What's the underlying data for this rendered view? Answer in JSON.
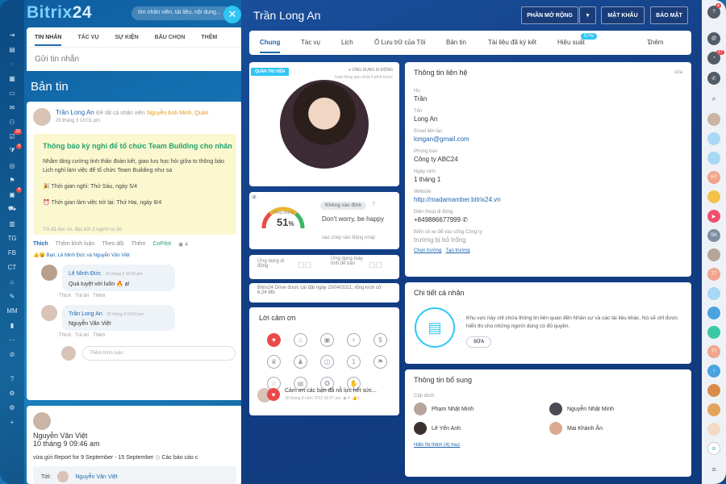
{
  "app": {
    "brand_part1": "Bitrix",
    "brand_part2": "24",
    "search_placeholder": "tìm nhân viên, tài liệu, nội dung..."
  },
  "leftnav": {
    "items": [
      "TG",
      "FB",
      "CT",
      "MM"
    ],
    "badges": [
      "18",
      "4",
      "4"
    ]
  },
  "feed": {
    "tabs": [
      "TIN NHẮN",
      "TÁC VỤ",
      "SỰ KIỆN",
      "BẦU CHỌN",
      "THÊM"
    ],
    "send_placeholder": "Gửi tin nhắn",
    "title": "Bản tin",
    "post": {
      "author": "Trần Long An",
      "to": "Đề tất cả nhân viên",
      "mention": "Nguyễn Anh Minh, Quản",
      "date": "25 tháng 3 10:01 pm",
      "headline": "Thông báo kỳ nghỉ để tổ chức Team Building cho nhân",
      "body": "Nhằm tăng cường tinh thần đoàn kết, giao lưu học hỏi giữa to thông báo Lịch nghỉ làm việc để tổ chức Team Building như sa",
      "line1": "Thời gian nghỉ: Thứ Sáu, ngày 5/4",
      "line2": "Thời gian làm việc trở lại: Thứ Hai, ngày 8/4",
      "readers": "Tôi đã đọc nó, đọc bởi 3 người tự đó",
      "actions": [
        "Thích",
        "Thêm bình luận",
        "Theo dõi",
        "Thêm",
        "CoPilot"
      ],
      "views": "4",
      "likes": "Bạn, Lê Minh Đức và Nguyễn Văn Việt",
      "comments": [
        {
          "name": "Lê Minh Đức",
          "date": "25 tháng 3 10:05 pm",
          "text": "Quá tuyệt vời luôn 🔥 ạ!"
        },
        {
          "name": "Trần Long An",
          "date": "25 tháng 3 10:53 pm",
          "text": "Nguyễn Văn Việt"
        }
      ],
      "comment_actions": [
        "Thích",
        "Trả lời",
        "Thêm"
      ],
      "add_comment": "Thêm bình luận"
    },
    "post2": {
      "author": "Nguyễn Văn Việt",
      "date": "10 tháng 9 09:46 am",
      "text": "vừa gửi Report for 9 September - 15 September",
      "extra": "Các báo cáo c",
      "to_label": "Tới:",
      "to_name": "Nguyễn Văn Việt"
    }
  },
  "profile": {
    "name": "Trần Long An",
    "buttons": {
      "expand": "PHÂN MỞ RỘNG",
      "password": "MẬT KHẨU",
      "security": "BẢO MẬT"
    },
    "tabs": [
      "Chung",
      "Tác vụ",
      "Lịch",
      "Ổ Lưu trữ của Tôi",
      "Bản tin",
      "Tài liệu đã ký kết",
      "Hiệu suất",
      "Thêm"
    ],
    "efficiency_badge": "57%",
    "photo_card": {
      "role": "QUẢN TRỊ VIÊN",
      "mobile": "ỨNG DỤNG DI ĐỘNG",
      "activity": "hoạt động gần nhất 4 phút trước"
    },
    "mood": {
      "status": "Không xác định",
      "gauge_label": "công thẳng",
      "gauge_value": "51",
      "unit": "%",
      "quote": "Don't worry, be happy",
      "link": "sao chép vào Bảng nháp"
    },
    "apps": {
      "mobile": "Ứng dụng di động",
      "desktop": "Ứng dụng máy tính để bàn"
    },
    "drive": "Bitrix24 Drive được cài đặt ngày 20/04/2021, tổng kích cỡ 6.24 Mb",
    "thanks": {
      "title": "Lời cảm ơn",
      "message": "Cảm ơn các bạn đã nỗ lực hết sức...",
      "date": "30 tháng 8 năm 2021 06:07 pm",
      "views": "4",
      "likes": "1"
    },
    "contact": {
      "title": "Thông tin liên hệ",
      "edit": "sửa",
      "fields": [
        {
          "label": "Họ",
          "value": "Trần"
        },
        {
          "label": "Tên",
          "value": "Long An"
        },
        {
          "label": "Email liên lạc",
          "value": "longan@gmail.com"
        },
        {
          "label": "Phòng ban",
          "value": "Công ty ABC24"
        },
        {
          "label": "Ngày sinh",
          "value": "1 tháng 1"
        },
        {
          "label": "Website",
          "value": "http://madamamber.bitrix24.vn"
        },
        {
          "label": "Điện thoại di động",
          "value": "+849886677999"
        },
        {
          "label": "Biển số xe để vào cổng Công ty",
          "value": "trường bị bỏ trống"
        }
      ],
      "choose_fields": "Chọn trường",
      "create_fields": "Tạo trường"
    },
    "personal": {
      "title": "Chi tiết cá nhân",
      "text": "Khu vực này chỉ chứa thông tin liên quan đến Nhân sự và các tài liệu khác. Nó sẽ chỉ được hiển thị cho những người dùng có đủ quyền.",
      "edit": "SỬA"
    },
    "extra": {
      "title": "Thông tin bổ sung",
      "sub_label": "Cấp dưới",
      "people": [
        "Phạm Nhật Minh",
        "Nguyễn Nhật Minh",
        "Lê Yến Anh",
        "Mai Khánh Ân"
      ],
      "more": "Hiển thị thêm (4) mục"
    }
  },
  "rightbar": {
    "avatars": [
      "HT",
      "SK",
      "TT",
      "TT"
    ],
    "badge": "17"
  }
}
